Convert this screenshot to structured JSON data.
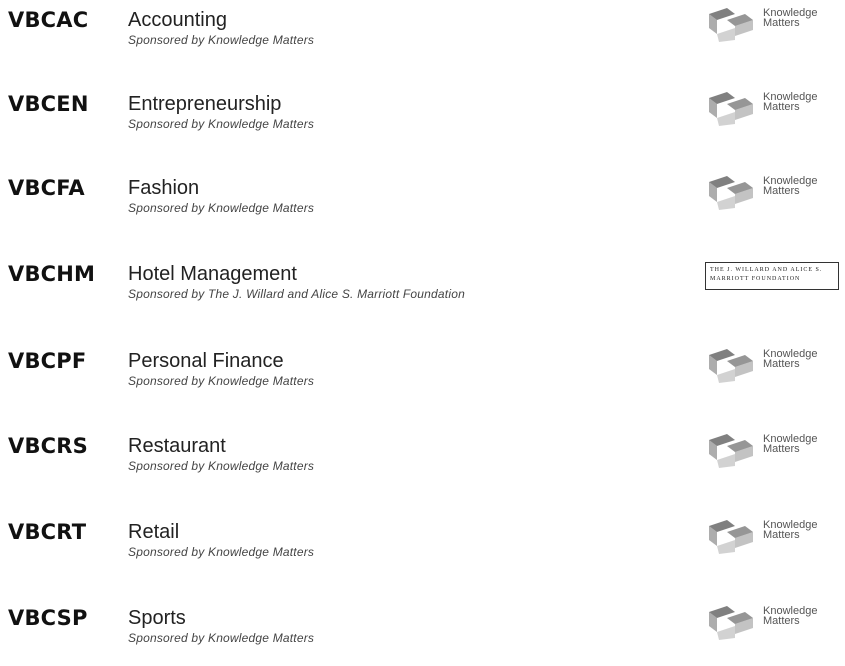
{
  "events": [
    {
      "code": "VBCAC",
      "title": "Accounting",
      "sponsor": "Sponsored by Knowledge Matters",
      "logo": "knowledge-matters"
    },
    {
      "code": "VBCEN",
      "title": "Entrepreneurship",
      "sponsor": "Sponsored by Knowledge Matters",
      "logo": "knowledge-matters"
    },
    {
      "code": "VBCFA",
      "title": "Fashion",
      "sponsor": "Sponsored by Knowledge Matters",
      "logo": "knowledge-matters"
    },
    {
      "code": "VBCHM",
      "title": "Hotel Management",
      "sponsor": "Sponsored by The J. Willard and Alice S. Marriott Foundation",
      "logo": "marriott-foundation"
    },
    {
      "code": "VBCPF",
      "title": "Personal Finance",
      "sponsor": "Sponsored by Knowledge Matters",
      "logo": "knowledge-matters"
    },
    {
      "code": "VBCRS",
      "title": "Restaurant",
      "sponsor": "Sponsored by Knowledge Matters",
      "logo": "knowledge-matters"
    },
    {
      "code": "VBCRT",
      "title": "Retail",
      "sponsor": "Sponsored by Knowledge Matters",
      "logo": "knowledge-matters"
    },
    {
      "code": "VBCSP",
      "title": "Sports",
      "sponsor": "Sponsored by Knowledge Matters",
      "logo": "knowledge-matters"
    }
  ],
  "logos": {
    "knowledge-matters": {
      "line1": "Knowledge",
      "line2": "Matters"
    },
    "marriott-foundation": {
      "line1": "The J. Willard and Alice S.",
      "line2": "Marriott Foundation"
    }
  }
}
